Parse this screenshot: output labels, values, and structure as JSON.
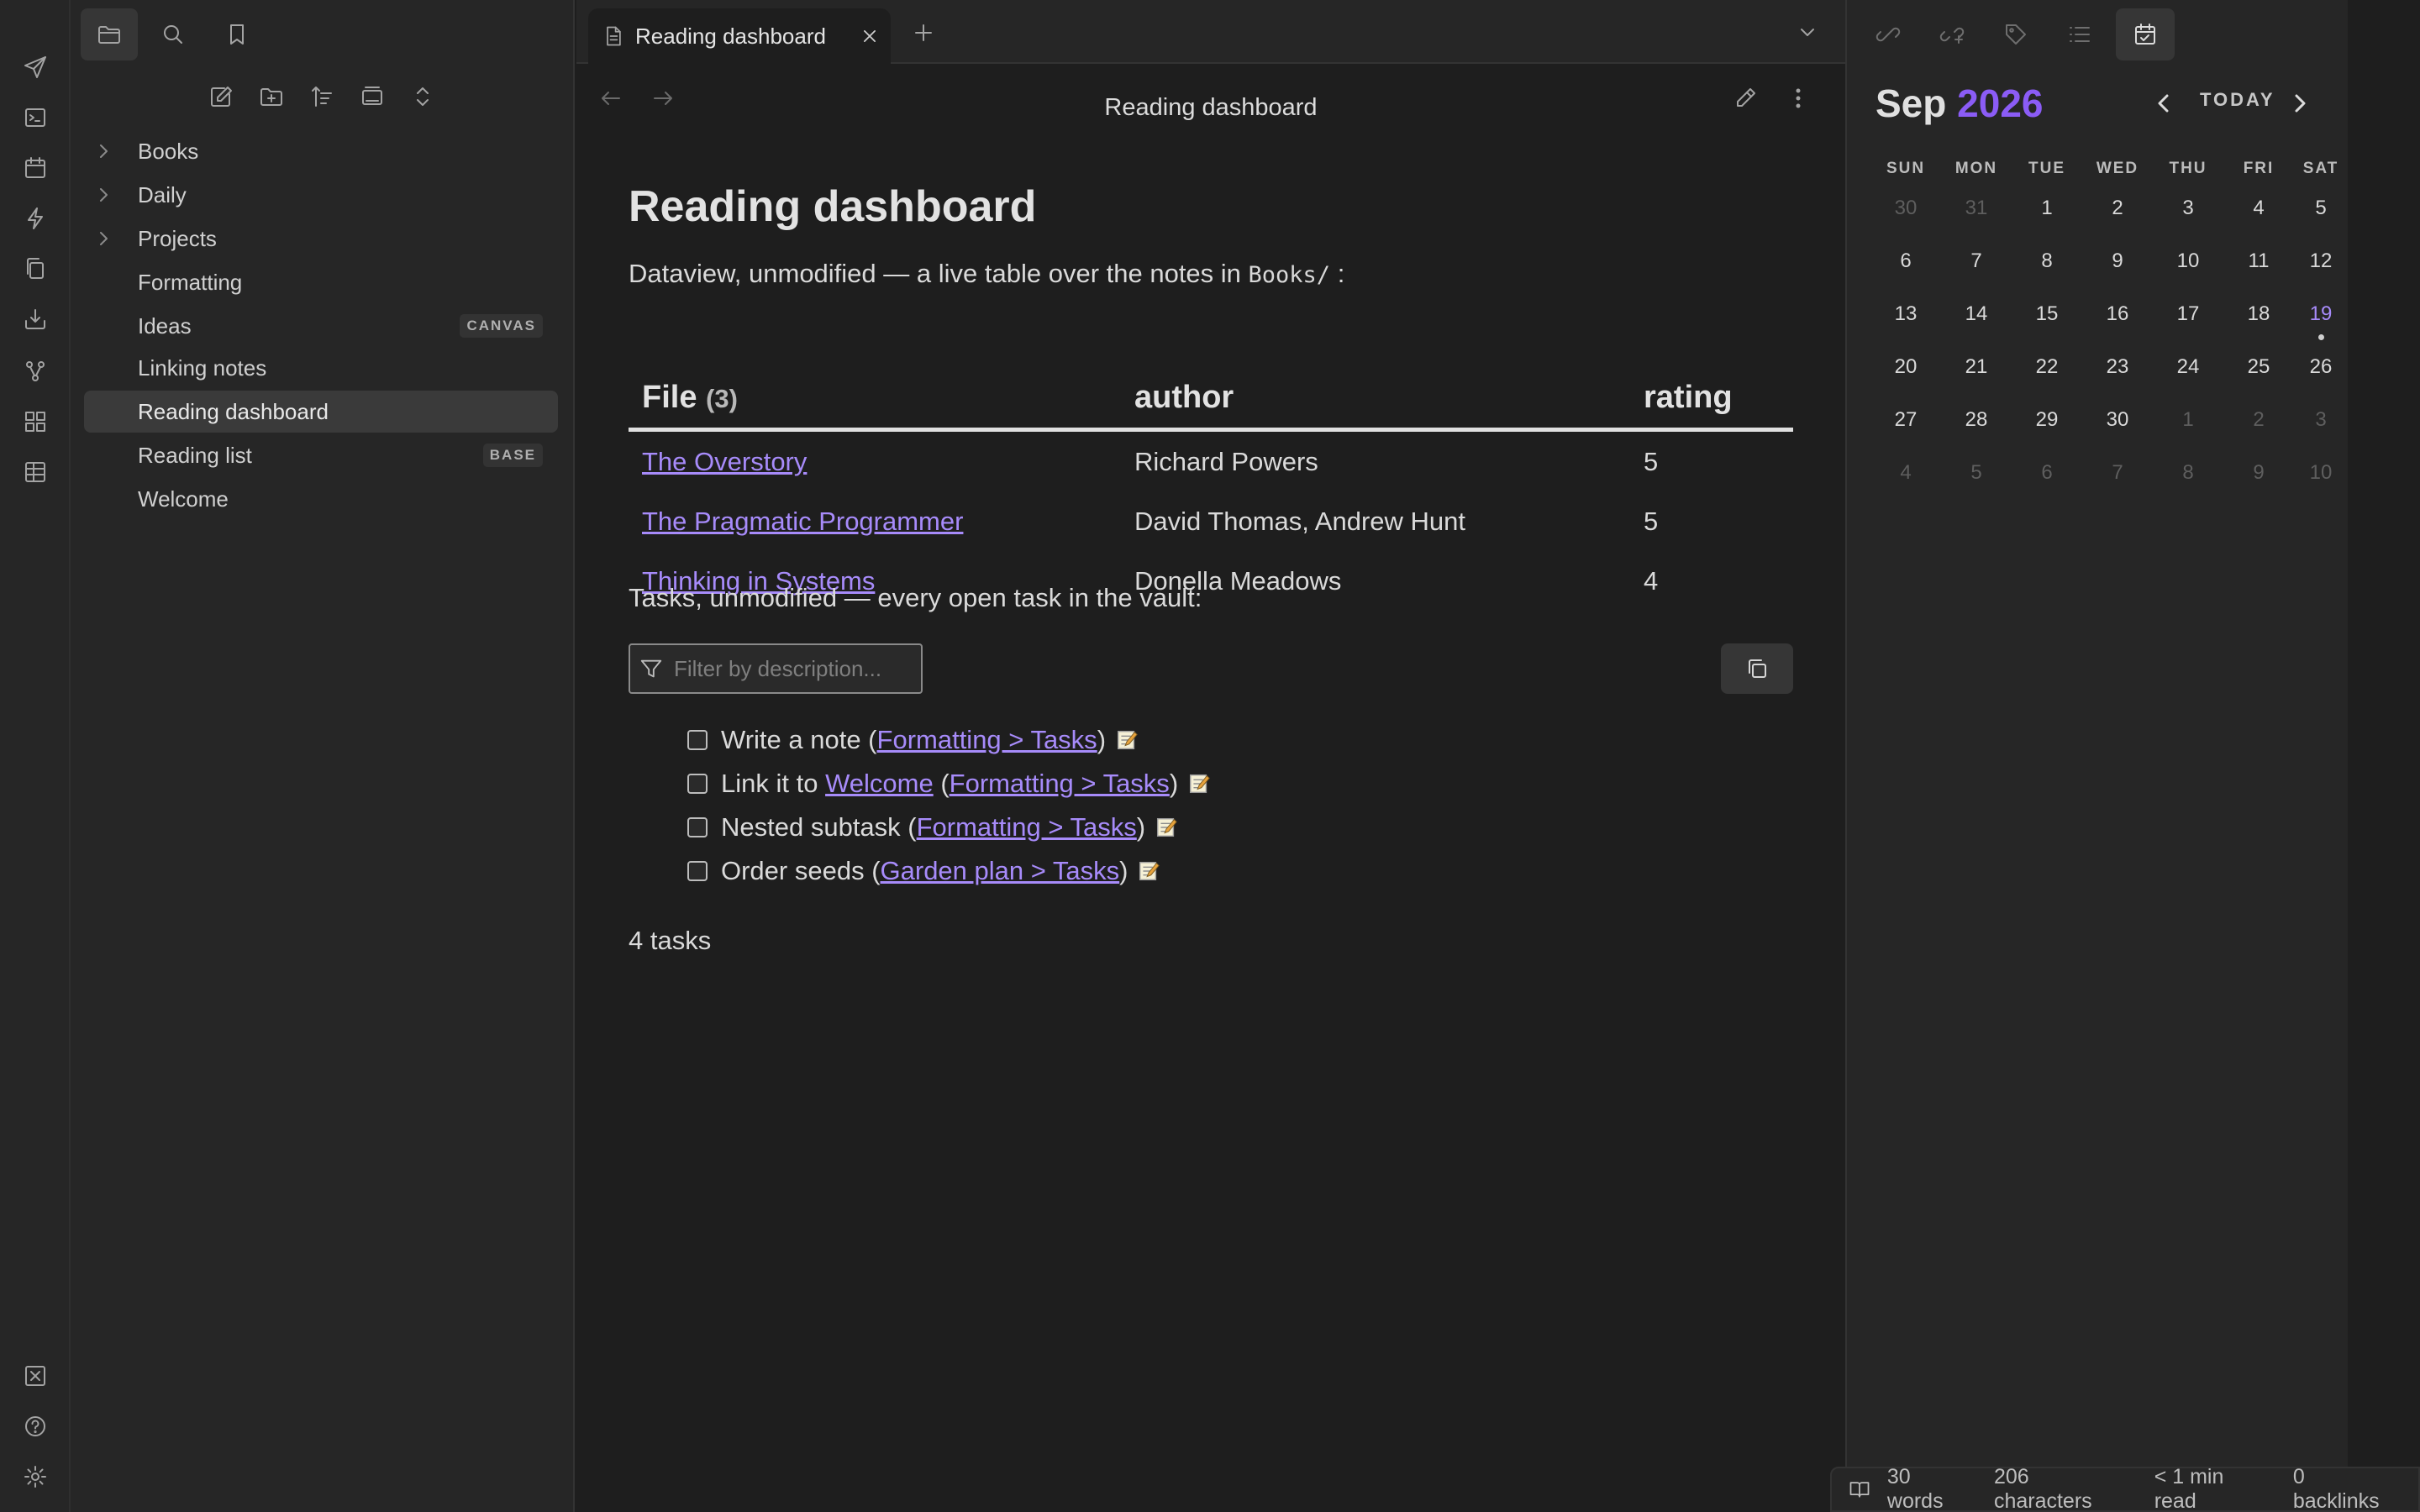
{
  "ribbon": {
    "icons": [
      "send-icon",
      "terminal-icon",
      "calendar-icon",
      "lightning-icon",
      "copy-files-icon",
      "import-icon",
      "graph-icon",
      "grid-icon",
      "table-icon",
      "close-box-icon",
      "help-icon",
      "settings-icon"
    ]
  },
  "sidebar": {
    "tabs": [
      "folder-icon",
      "search-icon",
      "bookmark-icon"
    ],
    "actions": [
      "new-note-icon",
      "new-folder-icon",
      "sort-icon",
      "collapse-icon",
      "expand-icon"
    ],
    "items": [
      {
        "label": "Books",
        "folder": true
      },
      {
        "label": "Daily",
        "folder": true
      },
      {
        "label": "Projects",
        "folder": true
      },
      {
        "label": "Formatting",
        "folder": false
      },
      {
        "label": "Ideas",
        "folder": false,
        "tag": "CANVAS"
      },
      {
        "label": "Linking notes",
        "folder": false
      },
      {
        "label": "Reading dashboard",
        "folder": false,
        "active": true
      },
      {
        "label": "Reading list",
        "folder": false,
        "tag": "BASE"
      },
      {
        "label": "Welcome",
        "folder": false
      }
    ]
  },
  "tab": {
    "label": "Reading dashboard"
  },
  "note": {
    "header_title": "Reading dashboard",
    "title": "Reading dashboard",
    "intro_text": "Dataview, unmodified — a live table over the notes in ",
    "intro_code": "Books/",
    "intro_suffix": " :",
    "table": {
      "headers": {
        "file": "File",
        "file_count": "(3)",
        "author": "author",
        "rating": "rating"
      },
      "rows": [
        {
          "file": "The Overstory",
          "author": "Richard Powers",
          "rating": "5"
        },
        {
          "file": "The Pragmatic Programmer",
          "author": "David Thomas, Andrew Hunt",
          "rating": "5"
        },
        {
          "file": "Thinking in Systems",
          "author": "Donella Meadows",
          "rating": "4"
        }
      ]
    },
    "tasks_intro": "Tasks, unmodified — every open task in the vault:",
    "filter_placeholder": "Filter by description...",
    "tasks": [
      {
        "pre": "Write a note (",
        "links": [
          "Formatting > Tasks"
        ],
        "post": ")"
      },
      {
        "pre": "Link it to ",
        "link1": "Welcome",
        "mid": " (",
        "link2": "Formatting > Tasks",
        "post": ")"
      },
      {
        "pre": "Nested subtask (",
        "links": [
          "Nested subtask"
        ],
        "link": "Formatting > Tasks",
        "post": ")"
      },
      {
        "pre": "Order seeds (",
        "link": "Garden plan > Tasks",
        "post": ")"
      }
    ],
    "task_count": "4 tasks"
  },
  "calendar": {
    "month": "Sep",
    "year": "2026",
    "today_label": "TODAY",
    "weekdays": [
      "SUN",
      "MON",
      "TUE",
      "WED",
      "THU",
      "FRI",
      "SAT"
    ],
    "weeks": [
      [
        "30",
        "31",
        "1",
        "2",
        "3",
        "4",
        "5"
      ],
      [
        "6",
        "7",
        "8",
        "9",
        "10",
        "11",
        "12"
      ],
      [
        "13",
        "14",
        "15",
        "16",
        "17",
        "18",
        "19"
      ],
      [
        "20",
        "21",
        "22",
        "23",
        "24",
        "25",
        "26"
      ],
      [
        "27",
        "28",
        "29",
        "30",
        "1",
        "2",
        "3"
      ],
      [
        "4",
        "5",
        "6",
        "7",
        "8",
        "9",
        "10"
      ]
    ]
  },
  "status": {
    "words": "30 words",
    "characters": "206 characters",
    "read_time": "< 1 min read",
    "backlinks": "0 backlinks"
  },
  "colors": {
    "accent": "#a78bfa",
    "year": "#8b5cf6",
    "background": "#1e1e1e",
    "panel": "#262626"
  }
}
